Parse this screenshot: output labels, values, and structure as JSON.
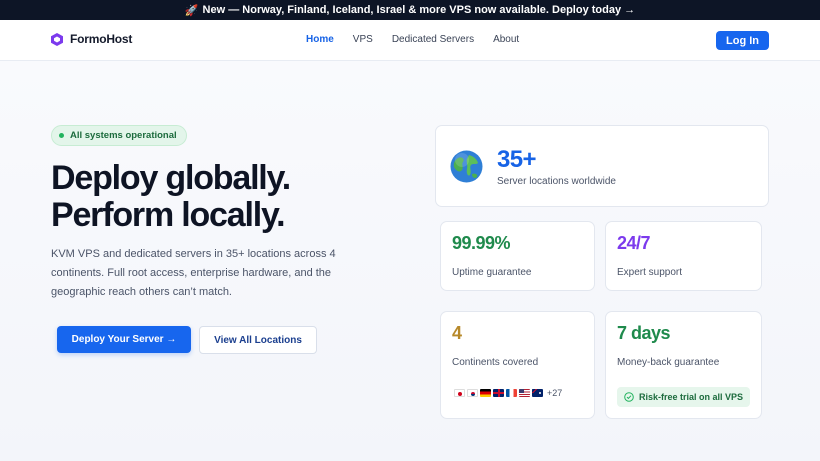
{
  "announcement": {
    "icon": "rocket-icon",
    "text": "New — Norway, Finland, Iceland, Israel & more VPS now available. Deploy today →"
  },
  "nav": {
    "brand": "FormoHost",
    "links": [
      "Home",
      "VPS",
      "Dedicated Servers",
      "About"
    ],
    "active": "Home",
    "login": "Log In"
  },
  "hero": {
    "status": "All systems operational",
    "headline_line1": "Deploy globally.",
    "headline_line2": "Perform locally.",
    "description": "KVM VPS and dedicated servers in 35+ locations across 4 continents. Full root access, enterprise hardware, and the geographic reach others can’t match.",
    "primary_cta": "Deploy Your Server →",
    "secondary_cta": "View All Locations"
  },
  "stats": {
    "main": {
      "value": "35+",
      "label": "Server locations worldwide",
      "icon": "globe-icon"
    },
    "uptime": {
      "value": "99.99%",
      "label": "Uptime guarantee",
      "color": "#1f8a4c"
    },
    "support": {
      "value": "24/7",
      "label": "Expert support",
      "color": "#7c3aed"
    },
    "continents": {
      "value": "4",
      "label": "Continents covered",
      "color": "#b7892a",
      "flags_more": "+27"
    },
    "moneyback": {
      "value": "7 days",
      "label": "Money-back guarantee",
      "color": "#1f8a4c",
      "badge": "Risk-free trial on all VPS"
    }
  },
  "colors": {
    "accent": "#1766ee",
    "dark": "#0d1526",
    "success": "#22b35e"
  }
}
